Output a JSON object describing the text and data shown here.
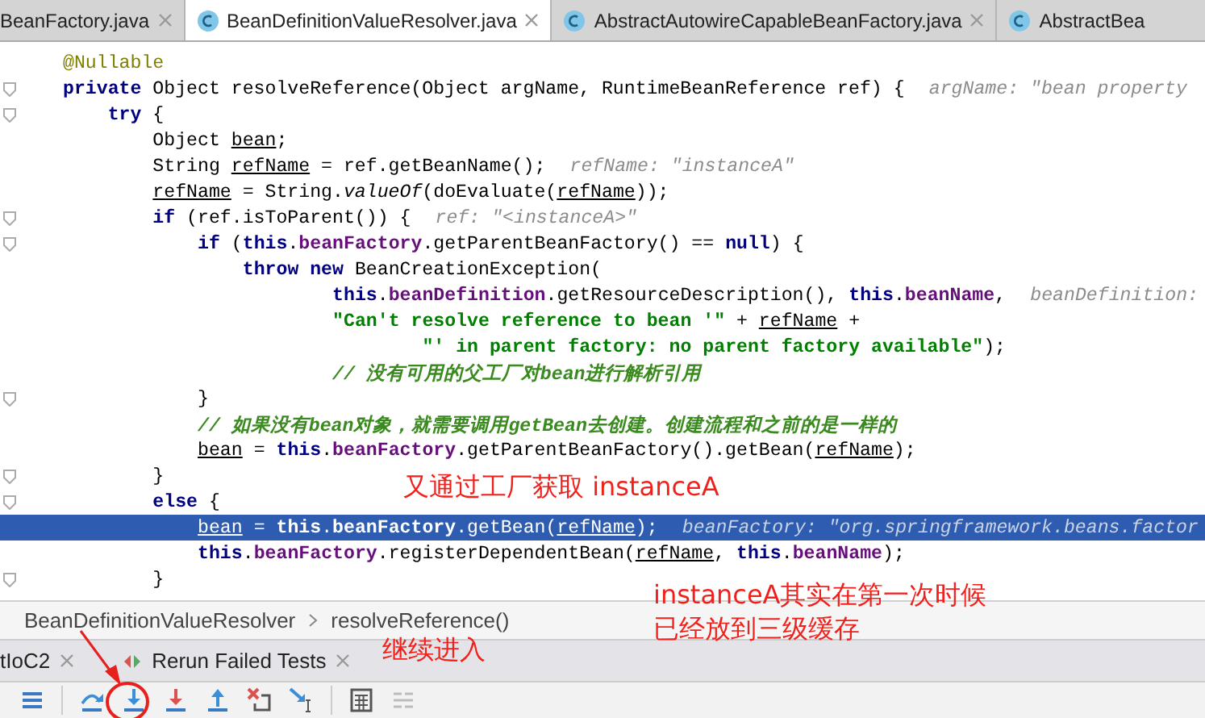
{
  "tabs": [
    {
      "label": "BeanFactory.java",
      "icon": false,
      "close": true,
      "selected": false
    },
    {
      "label": "BeanDefinitionValueResolver.java",
      "icon": true,
      "close": true,
      "selected": true
    },
    {
      "label": "AbstractAutowireCapableBeanFactory.java",
      "icon": true,
      "close": true,
      "selected": false
    },
    {
      "label": "AbstractBea",
      "icon": true,
      "close": false,
      "selected": false
    }
  ],
  "code": [
    {
      "fold": false,
      "selected": false,
      "tokens": [
        {
          "text": "@Nullable",
          "kind": "ann"
        }
      ]
    },
    {
      "fold": true,
      "selected": false,
      "tokens": [
        {
          "text": "private",
          "kind": "kw"
        },
        {
          "text": " Object resolveReference(Object argName, RuntimeBeanReference ref) {",
          "kind": "plain"
        },
        {
          "text": "argName: \"bean property",
          "kind": "hint"
        }
      ],
      "children": [
        {
          "fold": true,
          "selected": false,
          "tokens": [
            {
              "text": "try",
              "kind": "kw"
            },
            {
              "text": " {",
              "kind": "plain"
            }
          ],
          "children": [
            {
              "fold": false,
              "selected": false,
              "tokens": [
                {
                  "text": "Object ",
                  "kind": "plain"
                },
                {
                  "text": "bean",
                  "kind": "var"
                },
                {
                  "text": ";",
                  "kind": "plain"
                }
              ]
            },
            {
              "fold": false,
              "selected": false,
              "tokens": [
                {
                  "text": "String ",
                  "kind": "plain"
                },
                {
                  "text": "refName",
                  "kind": "var"
                },
                {
                  "text": " = ref.getBeanName();",
                  "kind": "plain"
                },
                {
                  "text": "refName: \"instanceA\"",
                  "kind": "hint"
                }
              ]
            },
            {
              "fold": false,
              "selected": false,
              "tokens": [
                {
                  "text": "refName",
                  "kind": "var"
                },
                {
                  "text": " = String.",
                  "kind": "plain"
                },
                {
                  "text": "valueOf",
                  "kind": "static"
                },
                {
                  "text": "(doEvaluate(",
                  "kind": "plain"
                },
                {
                  "text": "refName",
                  "kind": "var"
                },
                {
                  "text": "));",
                  "kind": "plain"
                }
              ]
            },
            {
              "fold": true,
              "selected": false,
              "tokens": [
                {
                  "text": "if",
                  "kind": "kw"
                },
                {
                  "text": " (ref.isToParent()) {",
                  "kind": "plain"
                },
                {
                  "text": "ref: \"<instanceA>\"",
                  "kind": "hint"
                }
              ],
              "children": [
                {
                  "fold": true,
                  "selected": false,
                  "tokens": [
                    {
                      "text": "if",
                      "kind": "kw"
                    },
                    {
                      "text": " (",
                      "kind": "plain"
                    },
                    {
                      "text": "this",
                      "kind": "kw"
                    },
                    {
                      "text": ".",
                      "kind": "plain"
                    },
                    {
                      "text": "beanFactory",
                      "kind": "field"
                    },
                    {
                      "text": ".getParentBeanFactory() == ",
                      "kind": "plain"
                    },
                    {
                      "text": "null",
                      "kind": "kw"
                    },
                    {
                      "text": ") {",
                      "kind": "plain"
                    }
                  ],
                  "children": [
                    {
                      "fold": false,
                      "selected": false,
                      "wrapped": true,
                      "tokens": [
                        {
                          "text": "throw new",
                          "kind": "kw"
                        },
                        {
                          "text": " BeanCreationException(",
                          "kind": "plain"
                        }
                      ],
                      "children": [
                        {
                          "fold": false,
                          "selected": false,
                          "tokens": [
                            {
                              "text": "this",
                              "kind": "kw"
                            },
                            {
                              "text": ".",
                              "kind": "plain"
                            },
                            {
                              "text": "beanDefinition",
                              "kind": "field"
                            },
                            {
                              "text": ".getResourceDescription(), ",
                              "kind": "plain"
                            },
                            {
                              "text": "this",
                              "kind": "kw"
                            },
                            {
                              "text": ".",
                              "kind": "plain"
                            },
                            {
                              "text": "beanName",
                              "kind": "field"
                            },
                            {
                              "text": ",",
                              "kind": "plain"
                            },
                            {
                              "text": "beanDefinition:",
                              "kind": "hint"
                            }
                          ]
                        },
                        {
                          "fold": false,
                          "selected": false,
                          "wrapped": true,
                          "tokens": [
                            {
                              "text": "\"Can't resolve reference to bean '\"",
                              "kind": "str"
                            },
                            {
                              "text": " + ",
                              "kind": "plain"
                            },
                            {
                              "text": "refName",
                              "kind": "var"
                            },
                            {
                              "text": " +",
                              "kind": "plain"
                            }
                          ],
                          "children": [
                            {
                              "fold": false,
                              "selected": false,
                              "tokens": [
                                {
                                  "text": "\"' in parent factory: no parent factory available\"",
                                  "kind": "str"
                                },
                                {
                                  "text": ");",
                                  "kind": "plain"
                                }
                              ]
                            }
                          ]
                        },
                        {
                          "fold": false,
                          "selected": false,
                          "tokens": [
                            {
                              "text": "// 没有可用的父工厂对bean进行解析引用",
                              "kind": "comment"
                            }
                          ]
                        }
                      ]
                    }
                  ]
                },
                {
                  "fold": true,
                  "selected": false,
                  "tokens": [
                    {
                      "text": "}",
                      "kind": "plain"
                    }
                  ]
                },
                {
                  "fold": false,
                  "selected": false,
                  "tokens": [
                    {
                      "text": "// 如果没有bean对象，就需要调用getBean去创建。创建流程和之前的是一样的",
                      "kind": "comment"
                    }
                  ]
                },
                {
                  "fold": false,
                  "selected": false,
                  "tokens": [
                    {
                      "text": "bean",
                      "kind": "var"
                    },
                    {
                      "text": " = ",
                      "kind": "plain"
                    },
                    {
                      "text": "this",
                      "kind": "kw"
                    },
                    {
                      "text": ".",
                      "kind": "plain"
                    },
                    {
                      "text": "beanFactory",
                      "kind": "field"
                    },
                    {
                      "text": ".getParentBeanFactory().getBean(",
                      "kind": "plain"
                    },
                    {
                      "text": "refName",
                      "kind": "var"
                    },
                    {
                      "text": ");",
                      "kind": "plain"
                    }
                  ]
                }
              ]
            },
            {
              "fold": true,
              "selected": false,
              "tokens": [
                {
                  "text": "}",
                  "kind": "plain"
                }
              ]
            },
            {
              "fold": true,
              "selected": false,
              "tokens": [
                {
                  "text": "else",
                  "kind": "kw"
                },
                {
                  "text": " {",
                  "kind": "plain"
                }
              ],
              "children": [
                {
                  "fold": false,
                  "selected": true,
                  "tokens": [
                    {
                      "text": "bean",
                      "kind": "var"
                    },
                    {
                      "text": " = ",
                      "kind": "plain"
                    },
                    {
                      "text": "this",
                      "kind": "kw"
                    },
                    {
                      "text": ".",
                      "kind": "plain"
                    },
                    {
                      "text": "beanFactory",
                      "kind": "field"
                    },
                    {
                      "text": ".getBean(",
                      "kind": "plain"
                    },
                    {
                      "text": "refName",
                      "kind": "var"
                    },
                    {
                      "text": ");",
                      "kind": "plain"
                    },
                    {
                      "text": "beanFactory: \"org.springframework.beans.factor",
                      "kind": "hint"
                    }
                  ]
                },
                {
                  "fold": false,
                  "selected": false,
                  "tokens": [
                    {
                      "text": "this",
                      "kind": "kw"
                    },
                    {
                      "text": ".",
                      "kind": "plain"
                    },
                    {
                      "text": "beanFactory",
                      "kind": "field"
                    },
                    {
                      "text": ".registerDependentBean(",
                      "kind": "plain"
                    },
                    {
                      "text": "refName",
                      "kind": "var"
                    },
                    {
                      "text": ", ",
                      "kind": "plain"
                    },
                    {
                      "text": "this",
                      "kind": "kw"
                    },
                    {
                      "text": ".",
                      "kind": "plain"
                    },
                    {
                      "text": "beanName",
                      "kind": "field"
                    },
                    {
                      "text": ");",
                      "kind": "plain"
                    }
                  ]
                }
              ]
            },
            {
              "fold": true,
              "selected": false,
              "tokens": [
                {
                  "text": "}",
                  "kind": "plain"
                }
              ]
            }
          ]
        }
      ]
    }
  ],
  "breadcrumb": [
    "BeanDefinitionValueResolver",
    "resolveReference()"
  ],
  "run_tabs": [
    {
      "label": "tIoC2",
      "kind": "plain"
    },
    {
      "label": "Rerun Failed Tests",
      "kind": "rerun"
    }
  ],
  "toolbar": [
    {
      "kind": "menu"
    },
    {
      "kind": "step-over"
    },
    {
      "kind": "step-into"
    },
    {
      "kind": "force-step-into"
    },
    {
      "kind": "step-out"
    },
    {
      "kind": "drop-frame"
    },
    {
      "kind": "run-to-cursor"
    },
    {
      "kind": "evaluate"
    },
    {
      "kind": "trace"
    }
  ],
  "annotations": [
    "又通过工厂获取 instanceA",
    "instanceA其实在第一次时候",
    "已经放到三级缓存",
    "继续进入"
  ]
}
